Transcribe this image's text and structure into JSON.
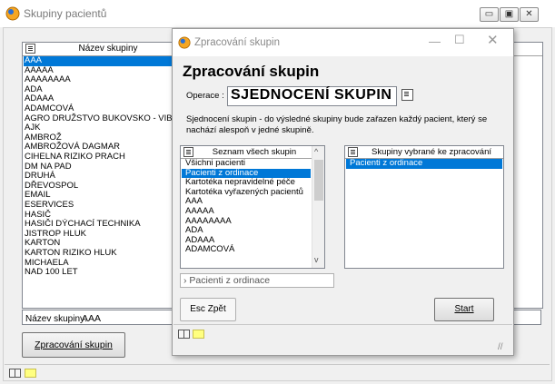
{
  "outer": {
    "title": "Skupiny pacientů",
    "list_header": "Název skupiny",
    "groups": [
      "AAA",
      "AAAAA",
      "AAAAAAAA",
      "ADA",
      "ADAAA",
      "ADAMCOVÁ",
      "AGRO DRUŽSTVO BUKOVSKO - VIB",
      "AJK",
      "AMBROŽ",
      "AMBROŽOVÁ DAGMAR",
      "CIHELNA RIZIKO PRACH",
      "DM NA PAD",
      "DRUHÁ",
      "DŘEVOSPOL",
      "EMAIL",
      "ESERVICES",
      "HASIČ",
      "HASIČI DÝCHACÍ TECHNIKA",
      "JISTROP HLUK",
      "KARTON",
      "KARTON RIZIKO HLUK",
      "MICHAELA",
      "NAD 100 LET"
    ],
    "name_label": "Název skupiny:",
    "name_value": "AAA",
    "process_button": "Zpracování skupin",
    "window_buttons": {
      "minimize": "▭",
      "maximize": "▣",
      "close": "✕"
    }
  },
  "dialog": {
    "title": "Zpracování skupin",
    "heading": "Zpracování skupin",
    "operation_label": "Operace :",
    "operation_value": "SJEDNOCENÍ SKUPIN",
    "description": "Sjednocení skupin - do výsledné skupiny bude zařazen každý pacient, který se nachází alespoň v jedné skupině.",
    "all_groups_header": "Seznam všech skupin",
    "all_groups": [
      "Všichni pacienti",
      "Pacienti z ordinace",
      "Kartotéka nepravidelné péče",
      "Kartotéka vyřazených pacientů",
      "AAA",
      "AAAAA",
      "AAAAAAAA",
      "ADA",
      "ADAAA",
      "ADAMCOVÁ"
    ],
    "all_groups_selected_index": 1,
    "selected_groups_header": "Skupiny vybrané ke zpracování",
    "selected_groups": [
      "Pacienti z ordinace"
    ],
    "filter_text": "› Pacienti z ordinace",
    "esc_button": "Esc Zpět",
    "start_button": "Start",
    "window_controls": {
      "minimize": "—",
      "maximize": "☐",
      "close": "✕"
    }
  }
}
